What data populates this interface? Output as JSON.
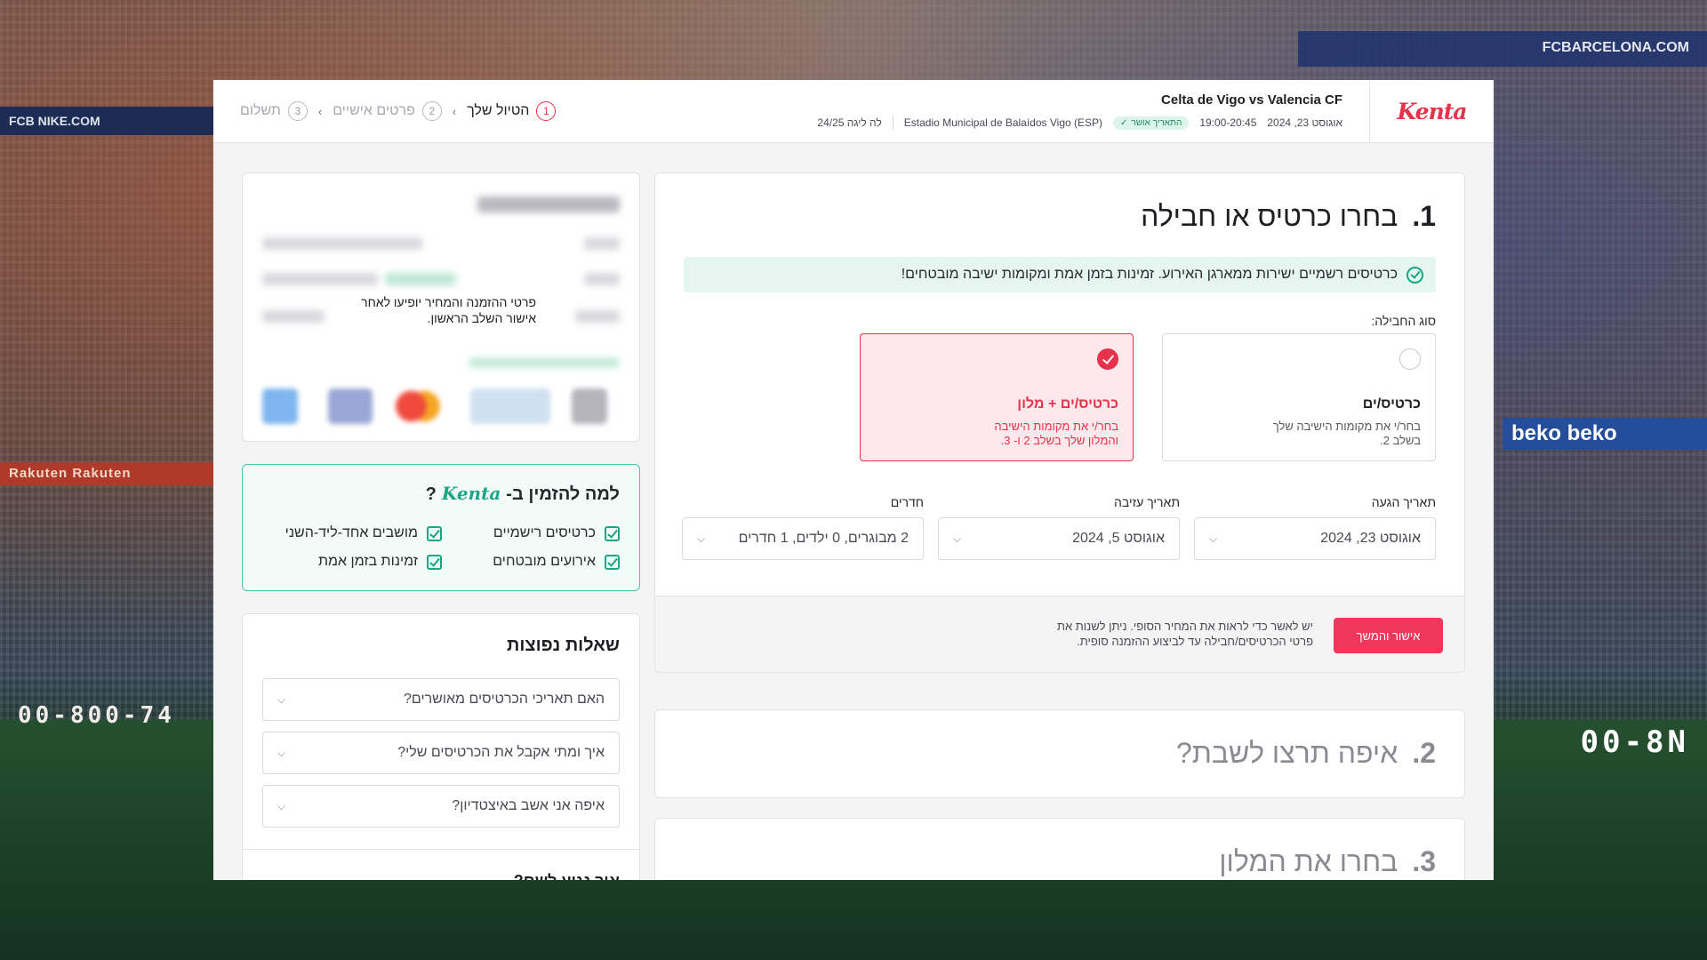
{
  "brand": {
    "logo": "Kenta",
    "accent": "#e8324c",
    "green": "#1aa684"
  },
  "event": {
    "title": "Celta de Vigo vs Valencia CF",
    "date": "אוגוסט 23, 2024",
    "time": "19:00-20:45",
    "date_badge": "התאריך אושר",
    "venue": "Estadio Municipal de Balaídos Vigo (ESP)",
    "league": "לה ליגה 24/25"
  },
  "steps": [
    {
      "num": "1",
      "label": "הטיול שלך"
    },
    {
      "num": "2",
      "label": "פרטים אישיים"
    },
    {
      "num": "3",
      "label": "תשלום"
    }
  ],
  "summary": {
    "placeholder_note": "פרטי ההזמנה והמחיר יופיעו לאחר אישור השלב הראשון."
  },
  "why": {
    "title_prefix": "למה להזמין ב-",
    "title_brand": "Kenta",
    "title_suffix": "?",
    "items": [
      "כרטיסים רישמיים",
      "מושבים אחד-ליד-השני",
      "אירועים מובטחים",
      "זמינות בזמן אמת"
    ]
  },
  "faq": {
    "title": "שאלות נפוצות",
    "items": [
      "האם תאריכי הכרטיסים מאושרים?",
      "איך ומתי אקבל את הכרטיסים שלי?",
      "איפה אני אשב באיצטדיון?"
    ],
    "more": "איך נגיע לשם?"
  },
  "step1": {
    "num": "1.",
    "title": "בחרו כרטיס או חבילה",
    "notice": "כרטיסים רשמיים ישירות ממארגן האירוע. זמינות בזמן אמת ומקומות ישיבה מובטחים!",
    "package_label": "סוג החבילה:",
    "packages": [
      {
        "name": "כרטיס/ים",
        "desc": "בחר/י את מקומות הישיבה שלך בשלב 2.",
        "selected": false
      },
      {
        "name": "כרטיס/ים + מלון",
        "desc": "בחר/י את מקומות הישיבה והמלון שלך בשלב 2 ו- 3.",
        "selected": true
      }
    ],
    "fields": {
      "arrival_label": "תאריך הגעה",
      "arrival_value": "אוגוסט 23, 2024",
      "departure_label": "תאריך עזיבה",
      "departure_value": "אוגוסט 5, 2024",
      "rooms_label": "חדרים",
      "rooms_value": "2 מבוגרים, 0 ילדים, 1 חדרים"
    },
    "confirm_button": "אישור והמשך",
    "confirm_note": "יש לאשר כדי לראות את המחיר הסופי. ניתן לשנות את פרטי הכרטיסים/חבילה עד לביצוע ההזמנה סופית."
  },
  "step2": {
    "num": "2.",
    "title": "איפה תרצו לשבת?"
  },
  "step3": {
    "num": "3.",
    "title": "בחרו את המלון"
  },
  "background": {
    "ad_left": "Rakuten  Rakuten",
    "ad_right": "beko  beko",
    "phone_left": "00-800-74",
    "phone_right": "00-8N",
    "fcb_left": "FCB  NIKE.COM",
    "fcb_right": "FCBARCELONA.COM"
  }
}
